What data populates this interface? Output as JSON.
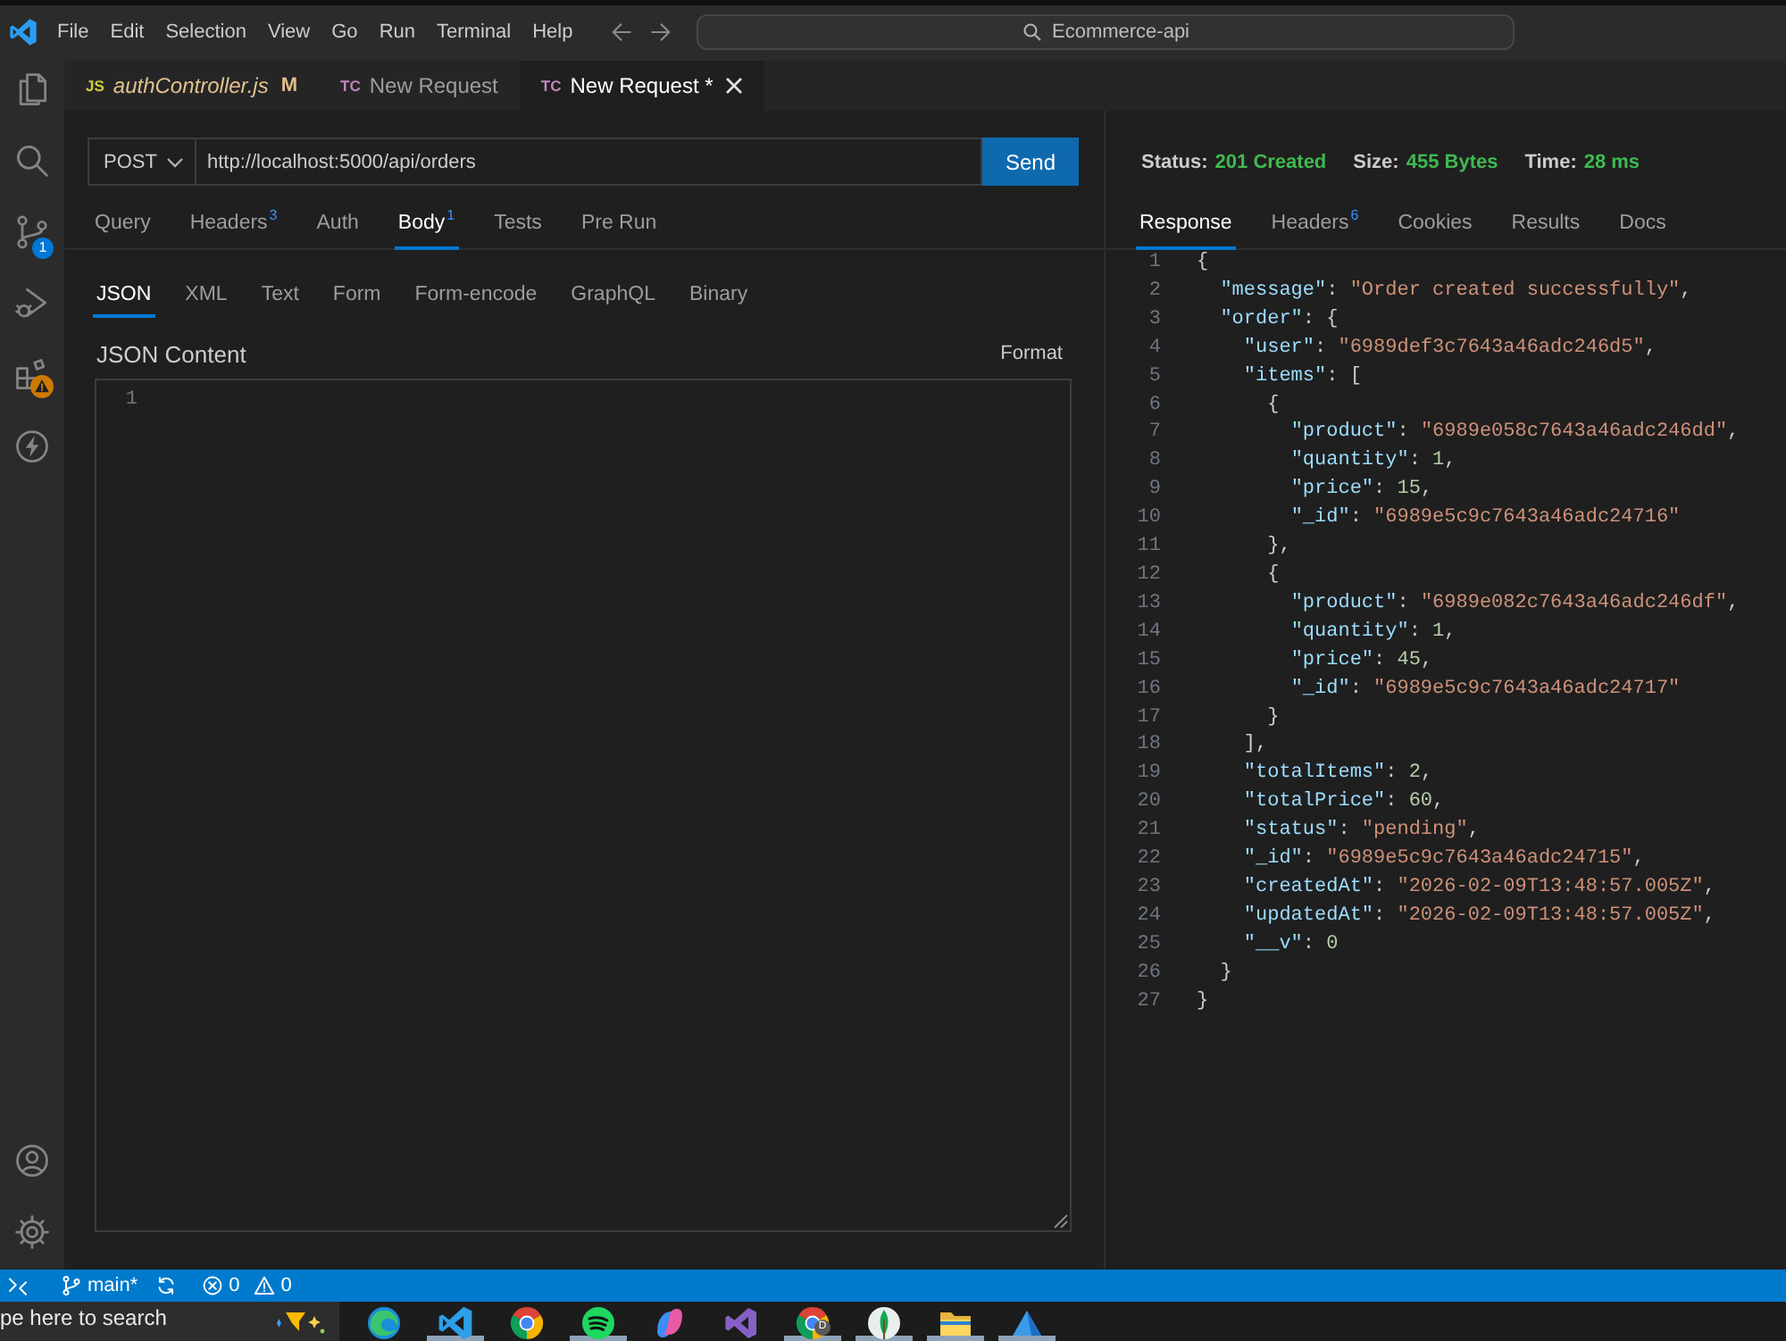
{
  "title_bar": {
    "menu": [
      "File",
      "Edit",
      "Selection",
      "View",
      "Go",
      "Run",
      "Terminal",
      "Help"
    ],
    "command_center": "Ecommerce-api"
  },
  "activity_bar": {
    "top": [
      {
        "kind": "files"
      },
      {
        "kind": "search"
      },
      {
        "kind": "source-control",
        "badge": "1"
      },
      {
        "kind": "run-debug"
      },
      {
        "kind": "extensions",
        "warning": true
      },
      {
        "kind": "thunder"
      }
    ],
    "bottom": [
      {
        "kind": "account"
      },
      {
        "kind": "settings"
      }
    ]
  },
  "tabs": [
    {
      "kind": "js",
      "icon": "JS",
      "label": "authController.js",
      "git_status": "M",
      "preview": true,
      "selected": false
    },
    {
      "kind": "tc",
      "icon": "TC",
      "label": "New Request",
      "preview": false,
      "selected": false
    },
    {
      "kind": "tc",
      "icon": "TC",
      "label": "New Request *",
      "preview": false,
      "selected": true
    }
  ],
  "request": {
    "method": "POST",
    "url": "http://localhost:5000/api/orders",
    "send": "Send",
    "tabs": [
      {
        "label": "Query",
        "selected": false
      },
      {
        "label": "Headers",
        "count": "3",
        "selected": false
      },
      {
        "label": "Auth",
        "selected": false
      },
      {
        "label": "Body",
        "count": "1",
        "selected": true
      },
      {
        "label": "Tests",
        "selected": false
      },
      {
        "label": "Pre Run",
        "selected": false
      }
    ],
    "body_types": [
      {
        "label": "JSON",
        "selected": true
      },
      {
        "label": "XML",
        "selected": false
      },
      {
        "label": "Text",
        "selected": false
      },
      {
        "label": "Form",
        "selected": false
      },
      {
        "label": "Form-encode",
        "selected": false
      },
      {
        "label": "GraphQL",
        "selected": false
      },
      {
        "label": "Binary",
        "selected": false
      }
    ],
    "content_label": "JSON Content",
    "format": "Format",
    "editor": {
      "line_numbers": [
        "1"
      ]
    }
  },
  "response": {
    "status": [
      {
        "label": "Status:",
        "value": "201 Created"
      },
      {
        "label": "Size:",
        "value": "455 Bytes"
      },
      {
        "label": "Time:",
        "value": "28 ms"
      }
    ],
    "tabs": [
      {
        "label": "Response",
        "selected": true
      },
      {
        "label": "Headers",
        "count": "6",
        "selected": false
      },
      {
        "label": "Cookies",
        "selected": false
      },
      {
        "label": "Results",
        "selected": false
      },
      {
        "label": "Docs",
        "selected": false
      }
    ],
    "lines": [
      {
        "number": "1",
        "text": "{"
      },
      {
        "number": "2",
        "text": "  \"message\": \"Order created successfully\","
      },
      {
        "number": "3",
        "text": "  \"order\": {"
      },
      {
        "number": "4",
        "text": "    \"user\": \"6989def3c7643a46adc246d5\","
      },
      {
        "number": "5",
        "text": "    \"items\": ["
      },
      {
        "number": "6",
        "text": "      {"
      },
      {
        "number": "7",
        "text": "        \"product\": \"6989e058c7643a46adc246dd\","
      },
      {
        "number": "8",
        "text": "        \"quantity\": 1,"
      },
      {
        "number": "9",
        "text": "        \"price\": 15,"
      },
      {
        "number": "10",
        "text": "        \"_id\": \"6989e5c9c7643a46adc24716\""
      },
      {
        "number": "11",
        "text": "      },"
      },
      {
        "number": "12",
        "text": "      {"
      },
      {
        "number": "13",
        "text": "        \"product\": \"6989e082c7643a46adc246df\","
      },
      {
        "number": "14",
        "text": "        \"quantity\": 1,"
      },
      {
        "number": "15",
        "text": "        \"price\": 45,"
      },
      {
        "number": "16",
        "text": "        \"_id\": \"6989e5c9c7643a46adc24717\""
      },
      {
        "number": "17",
        "text": "      }"
      },
      {
        "number": "18",
        "text": "    ],"
      },
      {
        "number": "19",
        "text": "    \"totalItems\": 2,"
      },
      {
        "number": "20",
        "text": "    \"totalPrice\": 60,"
      },
      {
        "number": "21",
        "text": "    \"status\": \"pending\","
      },
      {
        "number": "22",
        "text": "    \"_id\": \"6989e5c9c7643a46adc24715\","
      },
      {
        "number": "23",
        "text": "    \"createdAt\": \"2026-02-09T13:48:57.005Z\","
      },
      {
        "number": "24",
        "text": "    \"updatedAt\": \"2026-02-09T13:48:57.005Z\","
      },
      {
        "number": "25",
        "text": "    \"__v\": 0"
      },
      {
        "number": "26",
        "text": "  }"
      },
      {
        "number": "27",
        "text": "}"
      }
    ]
  },
  "status_bar": {
    "branch": "main*",
    "errors": "0",
    "warnings": "0"
  },
  "taskbar": {
    "search": {
      "placeholder": "pe here to search"
    },
    "apps": [
      {
        "kind": "swirl",
        "running": false
      },
      {
        "kind": "ribbon",
        "running": true
      },
      {
        "kind": "segmented",
        "running": false
      },
      {
        "kind": "waves",
        "running": true
      },
      {
        "kind": "knot",
        "running": false
      },
      {
        "kind": "infinity",
        "running": false
      },
      {
        "kind": "profile",
        "badge": "D",
        "running": true
      },
      {
        "kind": "leaf",
        "running": true
      },
      {
        "kind": "folder",
        "running": true
      },
      {
        "kind": "peak",
        "running": true
      }
    ]
  }
}
